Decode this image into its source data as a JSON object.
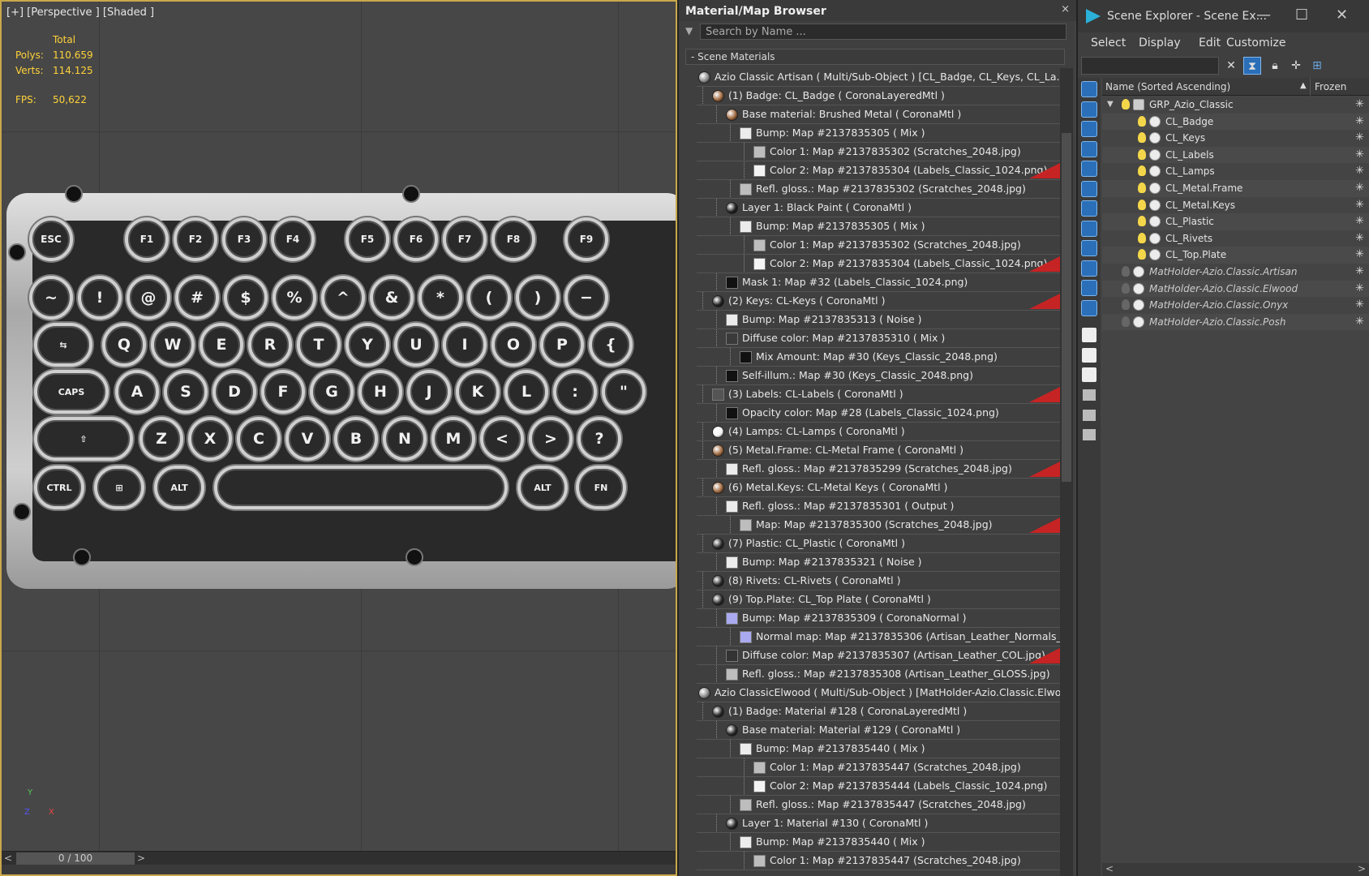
{
  "viewport": {
    "label": "[+] [Perspective ] [Shaded ]",
    "stats": {
      "total_label": "Total",
      "polys_label": "Polys:",
      "polys": "110.659",
      "verts_label": "Verts:",
      "verts": "114.125",
      "fps_label": "FPS:",
      "fps": "50,622"
    },
    "keys_fn": [
      "ESC",
      "F1",
      "F2",
      "F3",
      "F4",
      "F5",
      "F6",
      "F7",
      "F8",
      "F9"
    ],
    "keys_num": [
      "~",
      "!",
      "@",
      "#",
      "$",
      "%",
      "^",
      "&",
      "*",
      "(",
      ")",
      "−"
    ],
    "keys_q": [
      "⇆",
      "Q",
      "W",
      "E",
      "R",
      "T",
      "Y",
      "U",
      "I",
      "O",
      "P",
      "{"
    ],
    "keys_a": [
      "CAPS",
      "A",
      "S",
      "D",
      "F",
      "G",
      "H",
      "J",
      "K",
      "L",
      ":",
      "\""
    ],
    "keys_z": [
      "⇧",
      "Z",
      "X",
      "C",
      "V",
      "B",
      "N",
      "M",
      "<",
      ">",
      "?"
    ],
    "keys_bottom": [
      "CTRL",
      "⊞",
      "ALT",
      "",
      "ALT",
      "FN"
    ],
    "timeline": {
      "position": "0 / 100",
      "left": "<",
      "right": ">"
    },
    "axis": {
      "y": "Y",
      "z": "Z",
      "x": "X"
    }
  },
  "material_browser": {
    "title": "Material/Map Browser",
    "close": "×",
    "search_placeholder": "Search by Name ...",
    "section": "- Scene Materials",
    "rows": [
      {
        "depth": 0,
        "icon": "sphere",
        "color": "#8a8a8a",
        "text": "Azio Classic Artisan  ( Multi/Sub-Object ) [CL_Badge, CL_Keys, CL_La...",
        "flag": false
      },
      {
        "depth": 1,
        "icon": "sphere",
        "color": "#a06a40",
        "text": "(1) Badge: CL_Badge  ( CoronaLayeredMtl )",
        "flag": false
      },
      {
        "depth": 2,
        "icon": "sphere",
        "color": "#a06a40",
        "text": "Base material: Brushed Metal  ( CoronaMtl )",
        "flag": false
      },
      {
        "depth": 3,
        "icon": "square",
        "color": "#ececec",
        "text": "Bump: Map #2137835305  ( Mix )",
        "flag": false
      },
      {
        "depth": 4,
        "icon": "square",
        "color": "#bdbdbd",
        "text": "Color 1: Map #2137835302 (Scratches_2048.jpg)",
        "flag": false
      },
      {
        "depth": 4,
        "icon": "square",
        "color": "#f4f4f4",
        "text": "Color 2: Map #2137835304 (Labels_Classic_1024.png)",
        "flag": true
      },
      {
        "depth": 3,
        "icon": "square",
        "color": "#bdbdbd",
        "text": "Refl. gloss.: Map #2137835302 (Scratches_2048.jpg)",
        "flag": false
      },
      {
        "depth": 2,
        "icon": "sphere",
        "color": "#222222",
        "text": "Layer 1: Black Paint  ( CoronaMtl )",
        "flag": false
      },
      {
        "depth": 3,
        "icon": "square",
        "color": "#ececec",
        "text": "Bump: Map #2137835305  ( Mix )",
        "flag": false
      },
      {
        "depth": 4,
        "icon": "square",
        "color": "#bdbdbd",
        "text": "Color 1: Map #2137835302 (Scratches_2048.jpg)",
        "flag": false
      },
      {
        "depth": 4,
        "icon": "square",
        "color": "#f4f4f4",
        "text": "Color 2: Map #2137835304 (Labels_Classic_1024.png)",
        "flag": true
      },
      {
        "depth": 2,
        "icon": "square",
        "color": "#111111",
        "text": "Mask 1: Map #32 (Labels_Classic_1024.png)",
        "flag": false
      },
      {
        "depth": 1,
        "icon": "sphere",
        "color": "#222222",
        "text": "(2) Keys: CL-Keys  ( CoronaMtl )",
        "flag": true
      },
      {
        "depth": 2,
        "icon": "square",
        "color": "#ececec",
        "text": "Bump: Map #2137835313  ( Noise )",
        "flag": false
      },
      {
        "depth": 2,
        "icon": "square",
        "color": "#3a3a3a",
        "text": "Diffuse color: Map #2137835310  ( Mix )",
        "flag": false
      },
      {
        "depth": 3,
        "icon": "square",
        "color": "#111111",
        "text": "Mix Amount: Map #30 (Keys_Classic_2048.png)",
        "flag": false
      },
      {
        "depth": 2,
        "icon": "square",
        "color": "#111111",
        "text": "Self-illum.: Map #30 (Keys_Classic_2048.png)",
        "flag": false
      },
      {
        "depth": 1,
        "icon": "square",
        "color": "#555555",
        "text": "(3) Labels: CL-Labels  ( CoronaMtl )",
        "flag": true
      },
      {
        "depth": 2,
        "icon": "square",
        "color": "#111111",
        "text": "Opacity color: Map #28 (Labels_Classic_1024.png)",
        "flag": false
      },
      {
        "depth": 1,
        "icon": "sphere",
        "color": "#f4f4f4",
        "text": "(4) Lamps: CL-Lamps  ( CoronaMtl )",
        "flag": false
      },
      {
        "depth": 1,
        "icon": "sphere",
        "color": "#a06a40",
        "text": "(5) Metal.Frame: CL-Metal Frame  ( CoronaMtl )",
        "flag": false
      },
      {
        "depth": 2,
        "icon": "square",
        "color": "#ececec",
        "text": "Refl. gloss.: Map #2137835299 (Scratches_2048.jpg)",
        "flag": true
      },
      {
        "depth": 1,
        "icon": "sphere",
        "color": "#a06a40",
        "text": "(6) Metal.Keys: CL-Metal Keys  ( CoronaMtl )",
        "flag": false
      },
      {
        "depth": 2,
        "icon": "square",
        "color": "#ececec",
        "text": "Refl. gloss.: Map #2137835301  ( Output )",
        "flag": false
      },
      {
        "depth": 3,
        "icon": "square",
        "color": "#bdbdbd",
        "text": "Map: Map #2137835300 (Scratches_2048.jpg)",
        "flag": true
      },
      {
        "depth": 1,
        "icon": "sphere",
        "color": "#2a2a2a",
        "text": "(7) Plastic: CL_Plastic  ( CoronaMtl )",
        "flag": false
      },
      {
        "depth": 2,
        "icon": "square",
        "color": "#ececec",
        "text": "Bump: Map #2137835321  ( Noise )",
        "flag": false
      },
      {
        "depth": 1,
        "icon": "sphere",
        "color": "#2a2a2a",
        "text": "(8) Rivets: CL-Rivets  ( CoronaMtl )",
        "flag": false
      },
      {
        "depth": 1,
        "icon": "sphere",
        "color": "#2a2a2a",
        "text": "(9) Top.Plate: CL_Top Plate  ( CoronaMtl )",
        "flag": false
      },
      {
        "depth": 2,
        "icon": "square",
        "color": "#aaaaf0",
        "text": "Bump: Map #2137835309  ( CoronaNormal )",
        "flag": false
      },
      {
        "depth": 3,
        "icon": "square",
        "color": "#aaaaf0",
        "text": "Normal map: Map #2137835306 (Artisan_Leather_Normals_...",
        "flag": false
      },
      {
        "depth": 2,
        "icon": "square",
        "color": "#333333",
        "text": "Diffuse color: Map #2137835307 (Artisan_Leather_COL.jpg)",
        "flag": true
      },
      {
        "depth": 2,
        "icon": "square",
        "color": "#bdbdbd",
        "text": "Refl. gloss.: Map #2137835308 (Artisan_Leather_GLOSS.jpg)",
        "flag": false
      },
      {
        "depth": 0,
        "icon": "sphere",
        "color": "#8a8a8a",
        "text": "Azio ClassicElwood  ( Multi/Sub-Object ) [MatHolder-Azio.Classic.Elwo...",
        "flag": false
      },
      {
        "depth": 1,
        "icon": "sphere",
        "color": "#2a2a2a",
        "text": "(1) Badge: Material #128  ( CoronaLayeredMtl )",
        "flag": false
      },
      {
        "depth": 2,
        "icon": "sphere",
        "color": "#2a2a2a",
        "text": "Base material: Material #129  ( CoronaMtl )",
        "flag": false
      },
      {
        "depth": 3,
        "icon": "square",
        "color": "#ececec",
        "text": "Bump: Map #2137835440  ( Mix )",
        "flag": false
      },
      {
        "depth": 4,
        "icon": "square",
        "color": "#bdbdbd",
        "text": "Color 1: Map #2137835447 (Scratches_2048.jpg)",
        "flag": false
      },
      {
        "depth": 4,
        "icon": "square",
        "color": "#f4f4f4",
        "text": "Color 2: Map #2137835444 (Labels_Classic_1024.png)",
        "flag": false
      },
      {
        "depth": 3,
        "icon": "square",
        "color": "#bdbdbd",
        "text": "Refl. gloss.: Map #2137835447 (Scratches_2048.jpg)",
        "flag": false
      },
      {
        "depth": 2,
        "icon": "sphere",
        "color": "#2a2a2a",
        "text": "Layer 1: Material #130  ( CoronaMtl )",
        "flag": false
      },
      {
        "depth": 3,
        "icon": "square",
        "color": "#ececec",
        "text": "Bump: Map #2137835440  ( Mix )",
        "flag": false
      },
      {
        "depth": 4,
        "icon": "square",
        "color": "#bdbdbd",
        "text": "Color 1: Map #2137835447 (Scratches_2048.jpg)",
        "flag": false
      }
    ]
  },
  "scene_explorer": {
    "title": "Scene Explorer - Scene Ex...",
    "window_buttons": [
      "—",
      "☐",
      "✕"
    ],
    "menu": [
      "Select",
      "Display",
      "Edit",
      "Customize"
    ],
    "col_name": "Name (Sorted Ascending)",
    "col_sort": "▲",
    "col_frozen": "Frozen",
    "items": [
      {
        "depth": 0,
        "name": "GRP_Azio_Classic",
        "italic": false,
        "bulb": true,
        "type": "group"
      },
      {
        "depth": 1,
        "name": "CL_Badge",
        "italic": false,
        "bulb": true,
        "type": "obj"
      },
      {
        "depth": 1,
        "name": "CL_Keys",
        "italic": false,
        "bulb": true,
        "type": "obj"
      },
      {
        "depth": 1,
        "name": "CL_Labels",
        "italic": false,
        "bulb": true,
        "type": "obj"
      },
      {
        "depth": 1,
        "name": "CL_Lamps",
        "italic": false,
        "bulb": true,
        "type": "obj"
      },
      {
        "depth": 1,
        "name": "CL_Metal.Frame",
        "italic": false,
        "bulb": true,
        "type": "obj"
      },
      {
        "depth": 1,
        "name": "CL_Metal.Keys",
        "italic": false,
        "bulb": true,
        "type": "obj"
      },
      {
        "depth": 1,
        "name": "CL_Plastic",
        "italic": false,
        "bulb": true,
        "type": "obj"
      },
      {
        "depth": 1,
        "name": "CL_Rivets",
        "italic": false,
        "bulb": true,
        "type": "obj"
      },
      {
        "depth": 1,
        "name": "CL_Top.Plate",
        "italic": false,
        "bulb": true,
        "type": "obj"
      },
      {
        "depth": 0,
        "name": "MatHolder-Azio.Classic.Artisan",
        "italic": true,
        "bulb": false,
        "type": "obj"
      },
      {
        "depth": 0,
        "name": "MatHolder-Azio.Classic.Elwood",
        "italic": true,
        "bulb": false,
        "type": "obj"
      },
      {
        "depth": 0,
        "name": "MatHolder-Azio.Classic.Onyx",
        "italic": true,
        "bulb": false,
        "type": "obj"
      },
      {
        "depth": 0,
        "name": "MatHolder-Azio.Classic.Posh",
        "italic": true,
        "bulb": false,
        "type": "obj"
      }
    ],
    "frozen_icon": "✳",
    "hscroll_left": "<",
    "hscroll_right": ">"
  }
}
